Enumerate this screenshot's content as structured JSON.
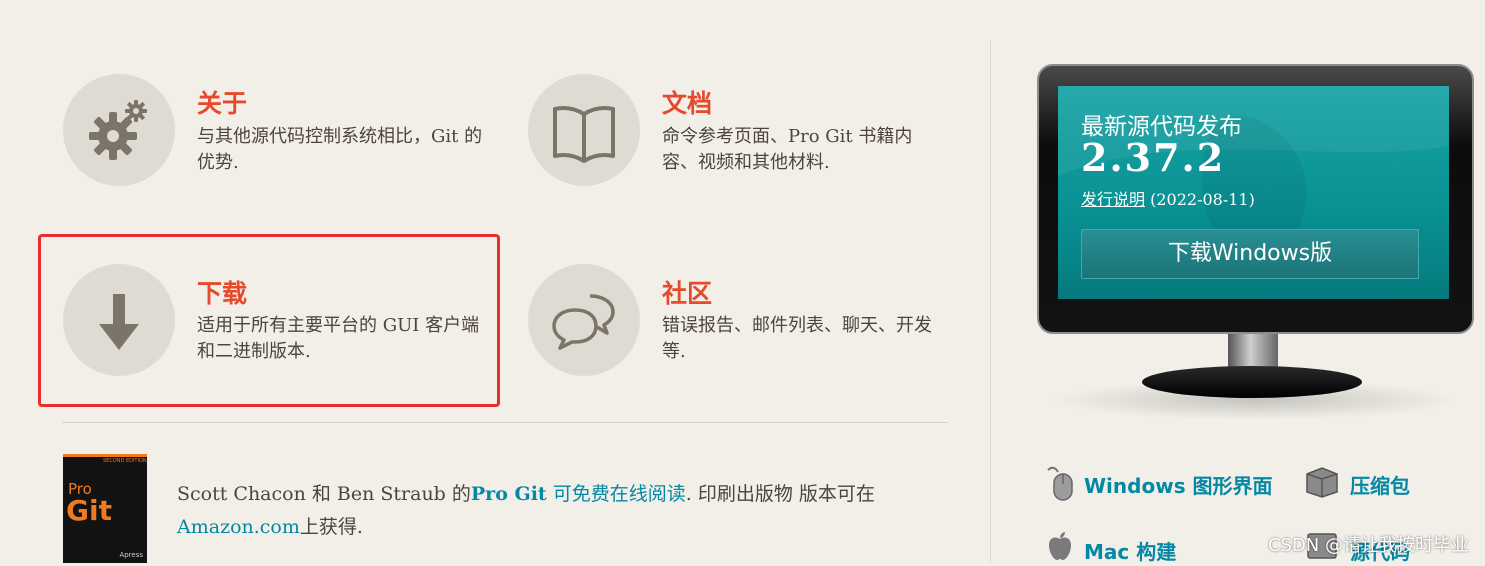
{
  "features": {
    "about": {
      "title": "关于",
      "desc": "与其他源代码控制系统相比，Git 的优势.",
      "icon": "gears-icon"
    },
    "docs": {
      "title": "文档",
      "desc": "命令参考页面、Pro Git 书籍内容、视频和其他材料.",
      "icon": "book-icon"
    },
    "downloads": {
      "title": "下载",
      "desc": "适用于所有主要平台的 GUI 客户端和二进制版本.",
      "icon": "download-arrow-icon"
    },
    "community": {
      "title": "社区",
      "desc": "错误报告、邮件列表、聊天、开发等.",
      "icon": "chat-bubbles-icon"
    }
  },
  "book": {
    "cover_edition": "SECOND EDITION",
    "cover_pro": "Pro",
    "cover_git": "Git",
    "cover_publisher": "Apress",
    "text_authors": "Scott Chacon 和 Ben Straub 的",
    "text_title": "Pro Git",
    "text_read_online": " 可免费在线阅读",
    "text_print": ". 印刷出版物 版本可在",
    "text_amazon": "Amazon.com",
    "text_available": "上获得."
  },
  "monitor": {
    "heading": "最新源代码发布",
    "version": "2.37.2",
    "release_notes": "发行说明",
    "release_date": " (2022-08-11)",
    "download_button": "下载Windows版"
  },
  "side_links": {
    "gui": "Windows 图形界面",
    "tarballs": "压缩包",
    "mac": "Mac 构建",
    "source": "源代码"
  },
  "watermark": "CSDN @请让我按时毕业",
  "colors": {
    "accent": "#e44a2b",
    "link": "#0388a6",
    "screen": "#0e9699",
    "highlight_box": "#e8302a"
  }
}
